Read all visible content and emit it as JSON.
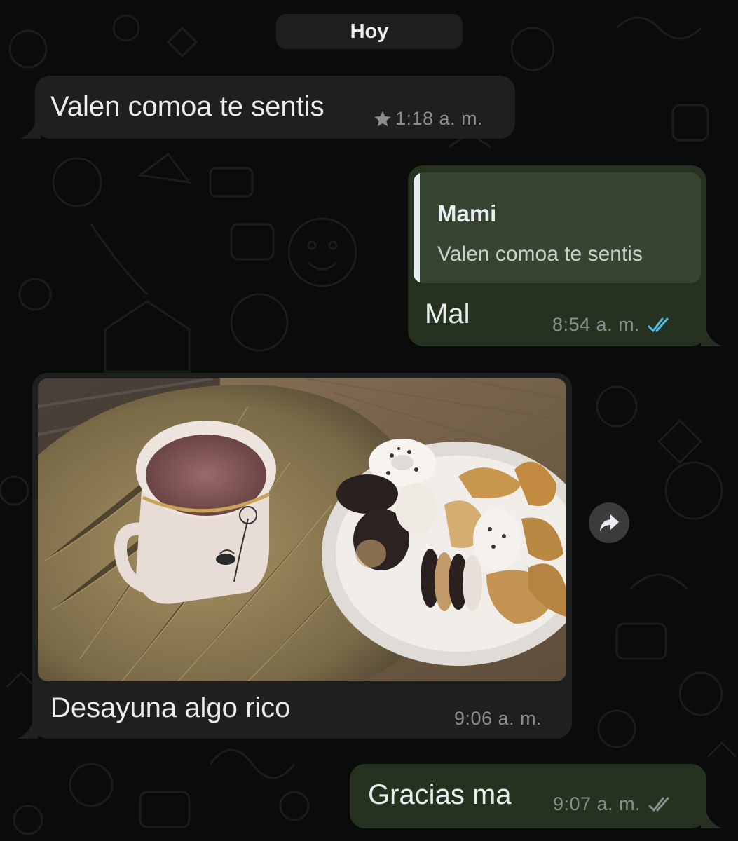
{
  "date_separator": "Hoy",
  "messages": [
    {
      "text": "Valen comoa te sentis",
      "time": "1:18 a. m.",
      "starred": true
    },
    {
      "quote": {
        "author": "Mami",
        "text": "Valen comoa te sentis"
      },
      "text": "Mal",
      "time": "8:54 a. m.",
      "status": "read"
    },
    {
      "text": "Desayuna algo rico",
      "time": "9:06 a. m.",
      "image": "photo of tea mug and plate of cookies"
    },
    {
      "text": "Gracias ma",
      "time": "9:07 a. m.",
      "status": "delivered"
    }
  ],
  "icons": {
    "star": "star-icon",
    "read_ticks": "double-check-blue-icon",
    "delivered_ticks": "double-check-gray-icon",
    "forward": "forward-icon"
  },
  "colors": {
    "incoming_bubble": "#1e1f1f",
    "outgoing_bubble": "#263220",
    "quote_background": "#364430",
    "read_tick": "#53bdeb",
    "meta_text": "#8a8f8d",
    "background": "#0b0b0b"
  }
}
